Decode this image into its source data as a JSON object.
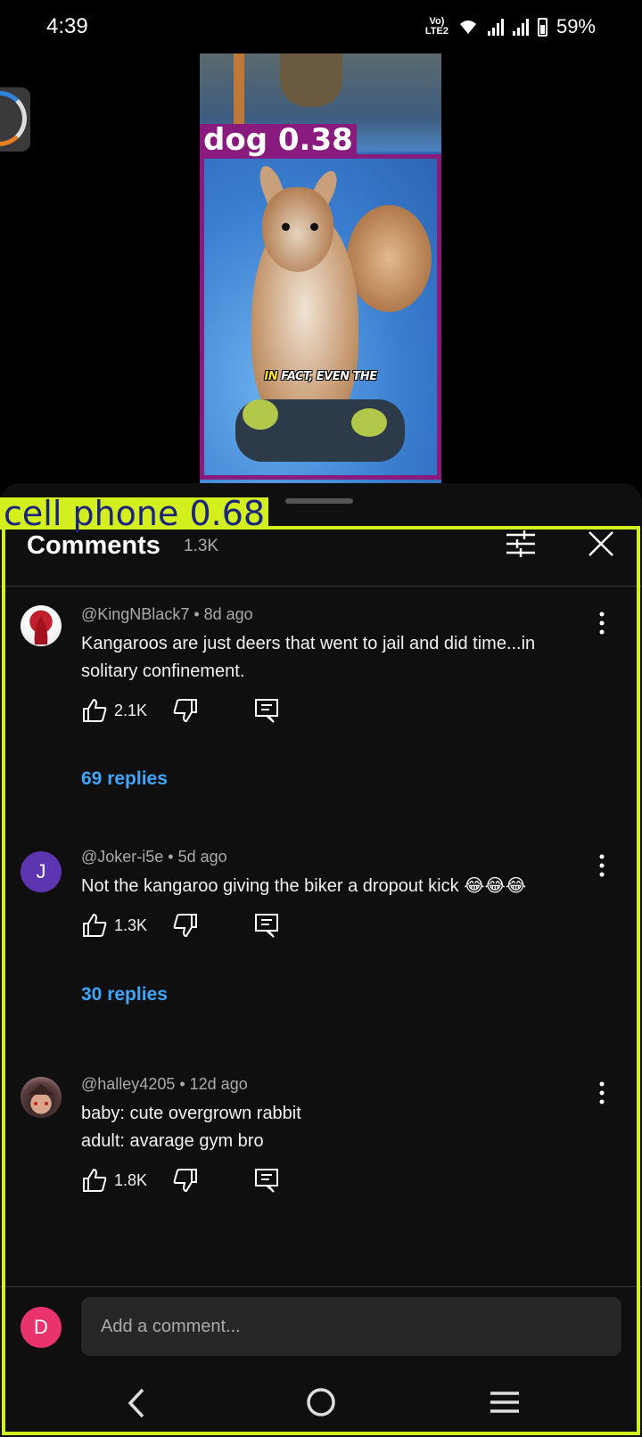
{
  "status_bar": {
    "time": "4:39",
    "network_label": "Vo) LTE2",
    "battery": "59%"
  },
  "video": {
    "caption_highlight": "IN",
    "caption_rest": " FACT, EVEN THE"
  },
  "detections": [
    {
      "label": "dog 0.38",
      "color": "#8a1b7e"
    },
    {
      "label": "cell phone 0.68",
      "color": "#d4ef1e"
    }
  ],
  "comments_sheet": {
    "title": "Comments",
    "count": "1.3K",
    "comments": [
      {
        "author": "@KingNBlack7",
        "age": "8d ago",
        "meta": "@KingNBlack7 • 8d ago",
        "text": "Kangaroos are just deers that went to jail and did time...in solitary confinement.",
        "likes": "2.1K",
        "replies": "69 replies"
      },
      {
        "author": "@Joker-i5e",
        "age": "5d ago",
        "meta": "@Joker-i5e • 5d ago",
        "avatar_letter": "J",
        "text": "Not the kangaroo giving the biker a dropout kick 😂😂😂",
        "likes": "1.3K",
        "replies": "30 replies"
      },
      {
        "author": "@halley4205",
        "age": "12d ago",
        "meta": "@halley4205 • 12d ago",
        "text_line1": "baby: cute overgrown rabbit",
        "text_line2": "adult: avarage gym bro",
        "likes": "1.8K"
      }
    ]
  },
  "add_comment": {
    "avatar_letter": "D",
    "placeholder": "Add a comment..."
  },
  "colors": {
    "accent_link": "#3ea6ff",
    "sheet_bg": "#0f0f0f",
    "joker_avatar": "#5e35b1",
    "me_avatar": "#e8336d"
  }
}
